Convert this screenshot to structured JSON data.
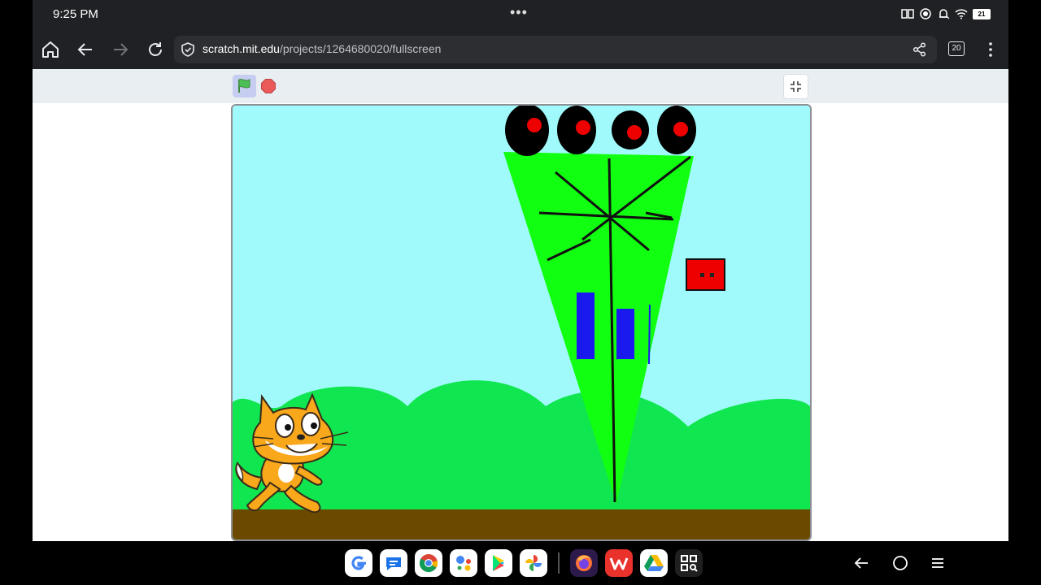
{
  "status_bar": {
    "time": "9:25 PM",
    "more_dots": "•••",
    "battery_level": "21"
  },
  "browser": {
    "url_domain": "scratch.mit.edu",
    "url_path": "/projects/1264680020/fullscreen",
    "tab_count": "20"
  },
  "player": {
    "green_flag_label": "Green Flag",
    "stop_label": "Stop",
    "exit_fullscreen_label": "Exit Full Screen"
  },
  "colors": {
    "sky": "#a0fafb",
    "hills": "#10e64f",
    "ground": "#6b4a00",
    "spinner_green": "#11ff11",
    "enemy_red": "#ee0000",
    "window_blue": "#1a1aee",
    "flag_green": "#4cbf56",
    "stop_red": "#ec5959"
  },
  "dock_apps": [
    {
      "name": "google-app-icon"
    },
    {
      "name": "messages-app-icon"
    },
    {
      "name": "chrome-app-icon"
    },
    {
      "name": "assistant-app-icon"
    },
    {
      "name": "play-store-app-icon"
    },
    {
      "name": "photos-app-icon"
    },
    {
      "name": "firefox-app-icon"
    },
    {
      "name": "wps-office-app-icon"
    },
    {
      "name": "drive-app-icon"
    },
    {
      "name": "app-drawer-icon"
    }
  ]
}
